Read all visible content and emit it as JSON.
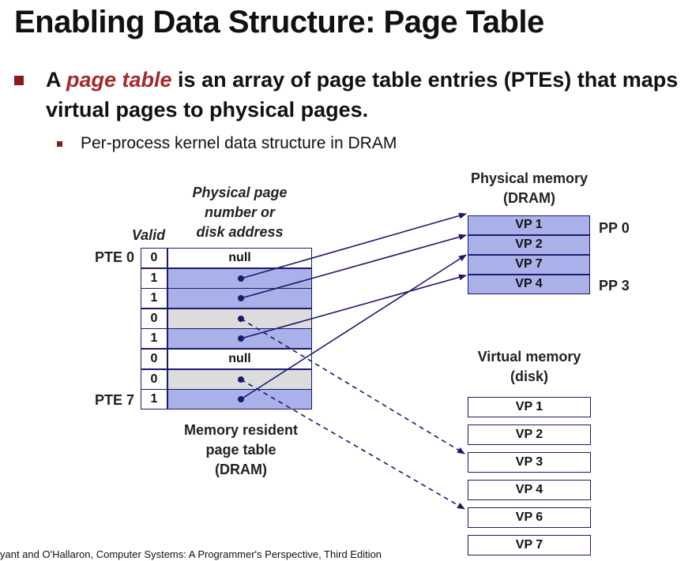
{
  "title": "Enabling Data Structure: Page Table",
  "bullet": {
    "prefix": "A ",
    "emphasis": "page table",
    "suffix": " is an array of page table entries (PTEs) that maps virtual pages to physical pages."
  },
  "sub_bullet": "Per-process kernel data structure in DRAM",
  "page_table": {
    "header_addr": [
      "Physical page",
      "number or",
      "disk address"
    ],
    "header_valid": "Valid",
    "first_label": "PTE 0",
    "last_label": "PTE 7",
    "rows": [
      {
        "valid": "0",
        "addr": "null",
        "shade": "white"
      },
      {
        "valid": "1",
        "addr": "",
        "shade": "blue"
      },
      {
        "valid": "1",
        "addr": "",
        "shade": "blue"
      },
      {
        "valid": "0",
        "addr": "",
        "shade": "gray"
      },
      {
        "valid": "1",
        "addr": "",
        "shade": "blue"
      },
      {
        "valid": "0",
        "addr": "null",
        "shade": "white"
      },
      {
        "valid": "0",
        "addr": "",
        "shade": "gray"
      },
      {
        "valid": "1",
        "addr": "",
        "shade": "blue"
      }
    ],
    "caption": [
      "Memory resident",
      "page table",
      "(DRAM)"
    ]
  },
  "physical_memory": {
    "title": [
      "Physical memory",
      "(DRAM)"
    ],
    "pages": [
      "VP 1",
      "VP 2",
      "VP 7",
      "VP 4"
    ],
    "first_label": "PP 0",
    "last_label": "PP 3"
  },
  "virtual_memory": {
    "title": [
      "Virtual memory",
      "(disk)"
    ],
    "pages": [
      "VP 1",
      "VP 2",
      "VP 3",
      "VP 4",
      "VP 6",
      "VP 7"
    ]
  },
  "footer": "yant and O'Hallaron, Computer Systems: A Programmer's Perspective, Third Edition",
  "colors": {
    "accent_red": "#a52a2a",
    "bullet_red": "#8b1a1a",
    "entry_blue": "#aab0e8",
    "arrow_navy": "#1a1a6e"
  }
}
